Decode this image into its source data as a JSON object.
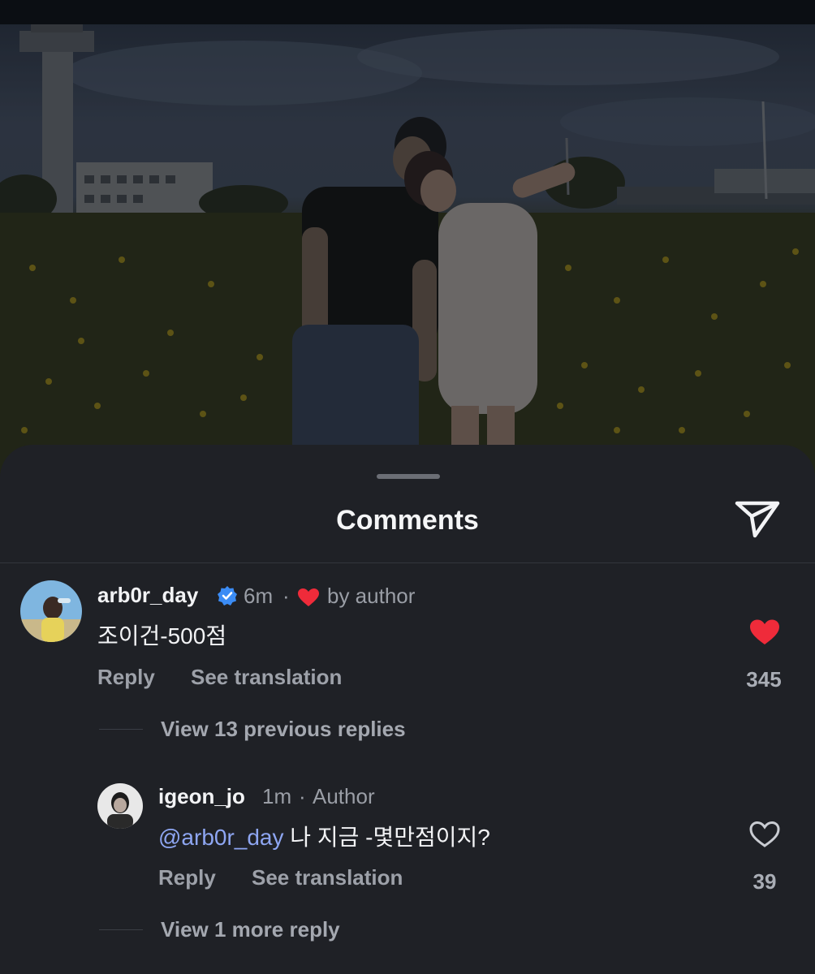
{
  "sheet": {
    "title": "Comments",
    "share_icon": "paper-plane-icon"
  },
  "comments": [
    {
      "username": "arb0r_day",
      "verified": true,
      "time": "6m",
      "separator": "·",
      "liked_by_author": "by author",
      "text": "조이건-500점",
      "reply_label": "Reply",
      "translate_label": "See translation",
      "likes": "345",
      "liked": true,
      "view_replies": "View 13 previous replies"
    },
    {
      "username": "igeon_jo",
      "time": "1m",
      "separator": "·",
      "badge": "Author",
      "mention": "@arb0r_day",
      "text": " 나 지금 -몇만점이지?",
      "reply_label": "Reply",
      "translate_label": "See translation",
      "likes": "39",
      "liked": false,
      "view_replies": "View 1 more reply"
    }
  ],
  "colors": {
    "sheet_bg": "#1f2126",
    "heart_red": "#ef2b3a",
    "verified_blue": "#3b8cf5",
    "mention_blue": "#8ea6f2"
  }
}
